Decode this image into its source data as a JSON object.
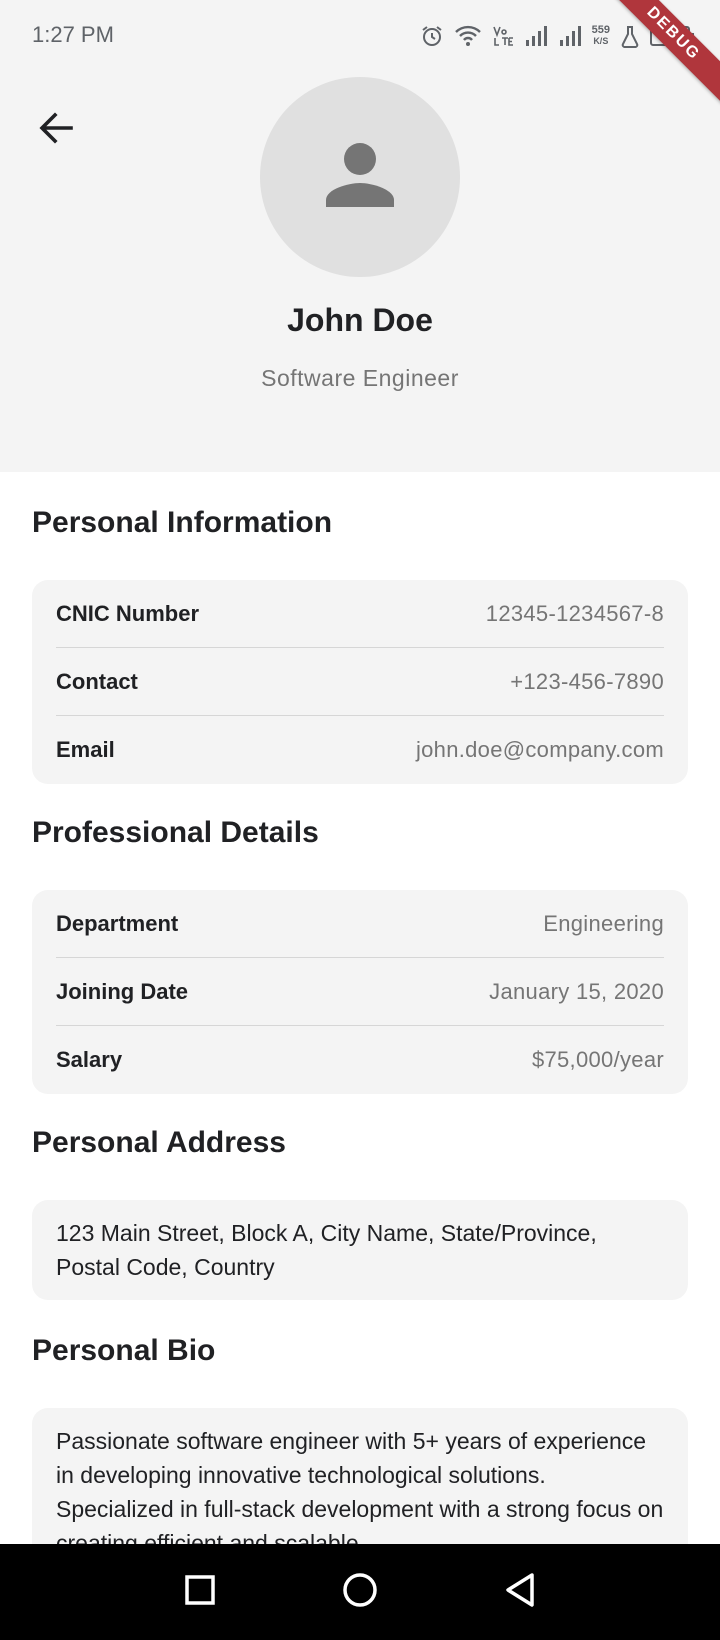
{
  "status_bar": {
    "time": "1:27 PM",
    "network_speed_value": "559",
    "network_speed_unit": "K/S",
    "debug_label": "DEBUG"
  },
  "profile": {
    "name": "John Doe",
    "role": "Software Engineer"
  },
  "personal_information": {
    "title": "Personal Information",
    "rows": [
      {
        "label": "CNIC Number",
        "value": "12345-1234567-8"
      },
      {
        "label": "Contact",
        "value": "+123-456-7890"
      },
      {
        "label": "Email",
        "value": "john.doe@company.com"
      }
    ]
  },
  "professional_details": {
    "title": "Professional Details",
    "rows": [
      {
        "label": "Department",
        "value": "Engineering"
      },
      {
        "label": "Joining Date",
        "value": "January 15, 2020"
      },
      {
        "label": "Salary",
        "value": "$75,000/year"
      }
    ]
  },
  "personal_address": {
    "title": "Personal Address",
    "text": "123 Main Street, Block A, City Name, State/Province, Postal Code, Country"
  },
  "personal_bio": {
    "title": "Personal Bio",
    "text": "Passionate software engineer with 5+ years of experience in developing innovative technological solutions. Specialized in full-stack development with a strong focus on creating efficient and scalable"
  },
  "icons": {
    "back": "arrow-left-icon",
    "avatar": "person-icon",
    "nav_recents": "square-icon",
    "nav_home": "circle-icon",
    "nav_back": "triangle-back-icon"
  },
  "colors": {
    "header_bg": "#f4f4f4",
    "card_bg": "#f4f4f4",
    "avatar_bg": "#e0e0e0",
    "debug_ribbon": "#b0363c",
    "secondary_text": "#757575"
  }
}
